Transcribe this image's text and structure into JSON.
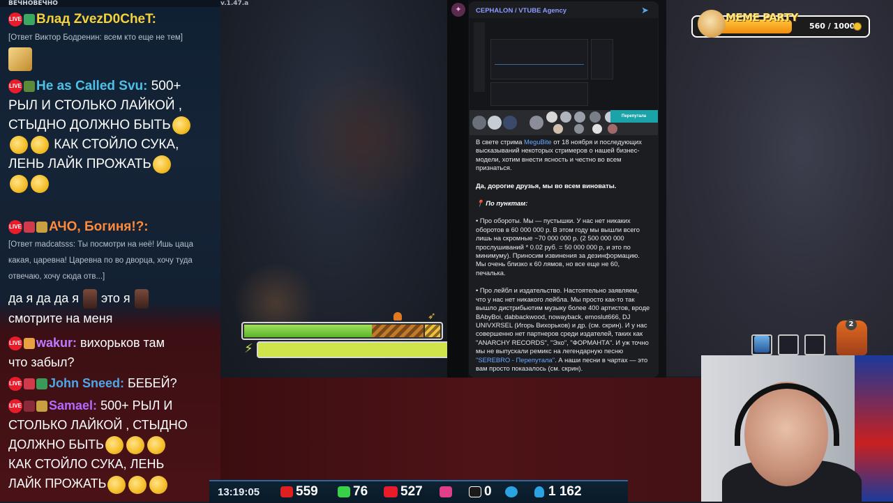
{
  "app_version": "v.1.47.a",
  "chat": {
    "top_label": "ВЕЧНОВЕЧНО",
    "messages": [
      {
        "nick": "Влад ZvezD0CheT:",
        "nick_color": "#f6d23a",
        "reply": "[Ответ Виктор Бодренин: всем кто еще не тем]"
      },
      {
        "nick": "He as Called Svu:",
        "nick_color": "#4ec0e8",
        "text1": "500+",
        "text2": "РЫЛ И СТОЛЬКО ЛАЙКОЙ ,",
        "text3": "СТЫДНО ДОЛЖНО БЫТЬ",
        "text4": "КАК СТОЙЛО СУКА,",
        "text5": "ЛЕНЬ ЛАЙК ПРОЖАТЬ"
      },
      {
        "nick": "АЧО, Богиня!?:",
        "nick_color": "#ff8a3a",
        "reply1": "[Ответ madcatsss: Ты посмотри на неё! Ишь цаца",
        "reply2": "какая, царевна! Царевна по во дворца, хочу туда",
        "reply3": "отвечаю, хочу сюда отв...]",
        "text1": "да я да да я",
        "text2": "это я",
        "text3": "смотрите на меня"
      },
      {
        "nick": "wakur:",
        "nick_color": "#c07aff",
        "text1": "вихорьков там",
        "text2": "что забыл?"
      },
      {
        "nick": "John Sneed:",
        "nick_color": "#4ea8e8",
        "text1": "БЕБЕЙ?"
      },
      {
        "nick": "Samael:",
        "nick_color": "#b36aff",
        "text1": "500+ РЫЛ И",
        "text2": "СТОЛЬКО ЛАЙКОЙ , СТЫДНО",
        "text3": "ДОЛЖНО БЫТЬ",
        "text4": "КАК СТОЙЛО СУКА, ЛЕНЬ",
        "text5": "ЛАЙК ПРОЖАТЬ"
      }
    ],
    "live_label": "LIVE"
  },
  "telegram": {
    "channel": "CEPHALON / VTUBE Agency",
    "tag": "Перепутала",
    "p1_pre": "В свете стрима ",
    "p1_link": "MeguBite",
    "p1_post": " от 18 ноября и последующих высказываний некоторых стримеров о нашей бизнес-модели, хотим внести ясность и честно во всем признаться.",
    "p2": "Да, дорогие друзья, мы во всем виноваты.",
    "p3": "📍 По пунктам:",
    "p4": "•  Про обороты. Мы — пустышки. У нас нет никаких оборотов в 60 000 000 р. В этом году мы вышли всего лишь на скромные ~70 000 000 р. (2 500 000 000 прослушиваний * 0.02 руб. = 50 000 000 р, и это по минимуму). Приносим извинения за дезинформацию. Мы очень близко к 60 лямов, но все еще не 60, печалька.",
    "p5_pre": "•  Про лейбл и издательство. Настоятельно заявляем, что у нас нет никакого лейбла. Мы просто как-то так вышло дистрибьютим музыку более 400 артистов, вроде BAbyBoi, dabbackwood, nowayback, emoslut666, DJ UNIVXRSEL (Игорь Вихорьков) и др. (см. скрин). И у нас совершенно нет партнеров среди издателей, таких как \"ANARCHY RECORDS\", \"Эхо\", \"ФОРМАНТА\". И уж точно мы не выпускали ремикс на легендарную песню ",
    "p5_link": "\"SEREBRO - Перепутала\"",
    "p5_post": ". А наши песни в чартах — это вам просто показалось (см. скрин)."
  },
  "meme_party": {
    "title": "MEME PARTY",
    "progress": "560 / 1000",
    "fraction": 0.56
  },
  "inventory": {
    "badge": "2"
  },
  "stats": {
    "time": "13:19:05",
    "youtube": "559",
    "kick": "76",
    "vk": "527",
    "trovo": "0",
    "rutube": "0",
    "viewers": "1 162"
  },
  "colors": {
    "live_red": "#ea1b2b",
    "accent_blue": "#2a6aa0",
    "tg_link": "#6aa9ff"
  }
}
